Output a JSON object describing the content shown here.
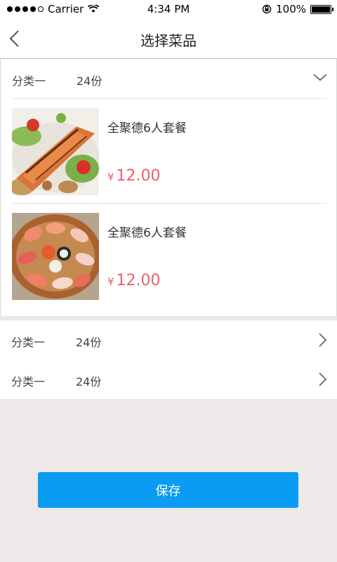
{
  "status_bar": {
    "carrier": "Carrier",
    "time": "4:34 PM",
    "battery": "100%"
  },
  "nav": {
    "title": "选择菜品"
  },
  "categories": [
    {
      "name": "分类一",
      "count": "24份",
      "expanded": true,
      "dishes": [
        {
          "name": "全聚德6人套餐",
          "currency": "¥",
          "price": "12.00",
          "image": "salmon-dish"
        },
        {
          "name": "全聚德6人套餐",
          "currency": "¥",
          "price": "12.00",
          "image": "sushi-platter"
        }
      ]
    },
    {
      "name": "分类一",
      "count": "24份",
      "expanded": false
    },
    {
      "name": "分类一",
      "count": "24份",
      "expanded": false
    }
  ],
  "actions": {
    "save_label": "保存"
  },
  "colors": {
    "accent": "#0a9cf3",
    "price": "#ec5f6c",
    "background": "#ece9e8"
  }
}
